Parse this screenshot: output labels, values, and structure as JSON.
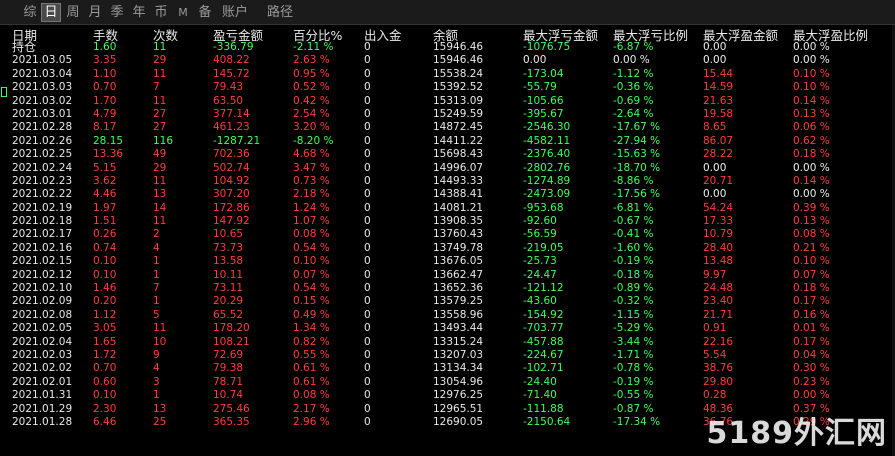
{
  "tabs": [
    "综",
    "日",
    "周",
    "月",
    "季",
    "年",
    "币",
    "M",
    "备",
    "账户",
    "路径"
  ],
  "active_tab": "日",
  "headers": [
    "日期",
    "手数",
    "次数",
    "盈亏金额",
    "百分比%",
    "出入金",
    "余额",
    "最大浮亏金额",
    "最大浮亏比例",
    "最大浮盈金额",
    "最大浮盈比例"
  ],
  "watermark": "5189外汇网",
  "colors": {
    "profit": "#ff3b3b",
    "loss": "#3cff5a",
    "neutral": "#ececec"
  },
  "rows": [
    {
      "date": "持仓",
      "lots": "1.60",
      "count": "11",
      "pnl": "-336.79",
      "pct": "-2.11 %",
      "flow": "0",
      "balance": "15946.46",
      "max_dd": "-1076.75",
      "max_dd_pct": "-6.87 %",
      "max_fp": "0.00",
      "max_fp_pct": "0.00 %",
      "sign": "loss",
      "dd_sign": "loss",
      "fp_sign": "neutral"
    },
    {
      "date": "2021.03.05",
      "lots": "3.35",
      "count": "29",
      "pnl": "408.22",
      "pct": "2.63 %",
      "flow": "0",
      "balance": "15946.46",
      "max_dd": "0.00",
      "max_dd_pct": "0.00 %",
      "max_fp": "0.00",
      "max_fp_pct": "0.00 %",
      "sign": "profit",
      "dd_sign": "neutral",
      "fp_sign": "neutral"
    },
    {
      "date": "2021.03.04",
      "lots": "1.10",
      "count": "11",
      "pnl": "145.72",
      "pct": "0.95 %",
      "flow": "0",
      "balance": "15538.24",
      "max_dd": "-173.04",
      "max_dd_pct": "-1.12 %",
      "max_fp": "15.44",
      "max_fp_pct": "0.10 %",
      "sign": "profit",
      "dd_sign": "loss",
      "fp_sign": "profit"
    },
    {
      "date": "2021.03.03",
      "lots": "0.70",
      "count": "7",
      "pnl": "79.43",
      "pct": "0.52 %",
      "flow": "0",
      "balance": "15392.52",
      "max_dd": "-55.79",
      "max_dd_pct": "-0.36 %",
      "max_fp": "14.59",
      "max_fp_pct": "0.10 %",
      "sign": "profit",
      "dd_sign": "loss",
      "fp_sign": "profit"
    },
    {
      "date": "2021.03.02",
      "lots": "1.70",
      "count": "11",
      "pnl": "63.50",
      "pct": "0.42 %",
      "flow": "0",
      "balance": "15313.09",
      "max_dd": "-105.66",
      "max_dd_pct": "-0.69 %",
      "max_fp": "21.63",
      "max_fp_pct": "0.14 %",
      "sign": "profit",
      "dd_sign": "loss",
      "fp_sign": "profit"
    },
    {
      "date": "2021.03.01",
      "lots": "4.79",
      "count": "27",
      "pnl": "377.14",
      "pct": "2.54 %",
      "flow": "0",
      "balance": "15249.59",
      "max_dd": "-395.67",
      "max_dd_pct": "-2.64 %",
      "max_fp": "19.58",
      "max_fp_pct": "0.13 %",
      "sign": "profit",
      "dd_sign": "loss",
      "fp_sign": "profit"
    },
    {
      "date": "2021.02.28",
      "lots": "8.17",
      "count": "27",
      "pnl": "461.23",
      "pct": "3.20 %",
      "flow": "0",
      "balance": "14872.45",
      "max_dd": "-2546.30",
      "max_dd_pct": "-17.67 %",
      "max_fp": "8.65",
      "max_fp_pct": "0.06 %",
      "sign": "profit",
      "dd_sign": "loss",
      "fp_sign": "profit"
    },
    {
      "date": "2021.02.26",
      "lots": "28.15",
      "count": "116",
      "pnl": "-1287.21",
      "pct": "-8.20 %",
      "flow": "0",
      "balance": "14411.22",
      "max_dd": "-4582.11",
      "max_dd_pct": "-27.94 %",
      "max_fp": "86.07",
      "max_fp_pct": "0.62 %",
      "sign": "loss",
      "dd_sign": "loss",
      "fp_sign": "profit"
    },
    {
      "date": "2021.02.25",
      "lots": "13.36",
      "count": "49",
      "pnl": "702.36",
      "pct": "4.68 %",
      "flow": "0",
      "balance": "15698.43",
      "max_dd": "-2376.40",
      "max_dd_pct": "-15.63 %",
      "max_fp": "28.22",
      "max_fp_pct": "0.18 %",
      "sign": "profit",
      "dd_sign": "loss",
      "fp_sign": "profit"
    },
    {
      "date": "2021.02.24",
      "lots": "5.15",
      "count": "29",
      "pnl": "502.74",
      "pct": "3.47 %",
      "flow": "0",
      "balance": "14996.07",
      "max_dd": "-2802.76",
      "max_dd_pct": "-18.70 %",
      "max_fp": "0.00",
      "max_fp_pct": "0.00 %",
      "sign": "profit",
      "dd_sign": "loss",
      "fp_sign": "neutral"
    },
    {
      "date": "2021.02.23",
      "lots": "3.62",
      "count": "11",
      "pnl": "104.92",
      "pct": "0.73 %",
      "flow": "0",
      "balance": "14493.33",
      "max_dd": "-1274.89",
      "max_dd_pct": "-8.86 %",
      "max_fp": "20.71",
      "max_fp_pct": "0.14 %",
      "sign": "profit",
      "dd_sign": "loss",
      "fp_sign": "profit"
    },
    {
      "date": "2021.02.22",
      "lots": "4.46",
      "count": "13",
      "pnl": "307.20",
      "pct": "2.18 %",
      "flow": "0",
      "balance": "14388.41",
      "max_dd": "-2473.09",
      "max_dd_pct": "-17.56 %",
      "max_fp": "0.00",
      "max_fp_pct": "0.00 %",
      "sign": "profit",
      "dd_sign": "loss",
      "fp_sign": "neutral"
    },
    {
      "date": "2021.02.19",
      "lots": "1.97",
      "count": "14",
      "pnl": "172.86",
      "pct": "1.24 %",
      "flow": "0",
      "balance": "14081.21",
      "max_dd": "-953.68",
      "max_dd_pct": "-6.81 %",
      "max_fp": "54.24",
      "max_fp_pct": "0.39 %",
      "sign": "profit",
      "dd_sign": "loss",
      "fp_sign": "profit"
    },
    {
      "date": "2021.02.18",
      "lots": "1.51",
      "count": "11",
      "pnl": "147.92",
      "pct": "1.07 %",
      "flow": "0",
      "balance": "13908.35",
      "max_dd": "-92.60",
      "max_dd_pct": "-0.67 %",
      "max_fp": "17.33",
      "max_fp_pct": "0.13 %",
      "sign": "profit",
      "dd_sign": "loss",
      "fp_sign": "profit"
    },
    {
      "date": "2021.02.17",
      "lots": "0.26",
      "count": "2",
      "pnl": "10.65",
      "pct": "0.08 %",
      "flow": "0",
      "balance": "13760.43",
      "max_dd": "-56.59",
      "max_dd_pct": "-0.41 %",
      "max_fp": "10.79",
      "max_fp_pct": "0.08 %",
      "sign": "profit",
      "dd_sign": "loss",
      "fp_sign": "profit"
    },
    {
      "date": "2021.02.16",
      "lots": "0.74",
      "count": "4",
      "pnl": "73.73",
      "pct": "0.54 %",
      "flow": "0",
      "balance": "13749.78",
      "max_dd": "-219.05",
      "max_dd_pct": "-1.60 %",
      "max_fp": "28.40",
      "max_fp_pct": "0.21 %",
      "sign": "profit",
      "dd_sign": "loss",
      "fp_sign": "profit"
    },
    {
      "date": "2021.02.15",
      "lots": "0.10",
      "count": "1",
      "pnl": "13.58",
      "pct": "0.10 %",
      "flow": "0",
      "balance": "13676.05",
      "max_dd": "-25.73",
      "max_dd_pct": "-0.19 %",
      "max_fp": "13.48",
      "max_fp_pct": "0.10 %",
      "sign": "profit",
      "dd_sign": "loss",
      "fp_sign": "profit"
    },
    {
      "date": "2021.02.12",
      "lots": "0.10",
      "count": "1",
      "pnl": "10.11",
      "pct": "0.07 %",
      "flow": "0",
      "balance": "13662.47",
      "max_dd": "-24.47",
      "max_dd_pct": "-0.18 %",
      "max_fp": "9.97",
      "max_fp_pct": "0.07 %",
      "sign": "profit",
      "dd_sign": "loss",
      "fp_sign": "profit"
    },
    {
      "date": "2021.02.10",
      "lots": "1.46",
      "count": "7",
      "pnl": "73.11",
      "pct": "0.54 %",
      "flow": "0",
      "balance": "13652.36",
      "max_dd": "-121.12",
      "max_dd_pct": "-0.89 %",
      "max_fp": "24.48",
      "max_fp_pct": "0.18 %",
      "sign": "profit",
      "dd_sign": "loss",
      "fp_sign": "profit"
    },
    {
      "date": "2021.02.09",
      "lots": "0.20",
      "count": "1",
      "pnl": "20.29",
      "pct": "0.15 %",
      "flow": "0",
      "balance": "13579.25",
      "max_dd": "-43.60",
      "max_dd_pct": "-0.32 %",
      "max_fp": "23.40",
      "max_fp_pct": "0.17 %",
      "sign": "profit",
      "dd_sign": "loss",
      "fp_sign": "profit"
    },
    {
      "date": "2021.02.08",
      "lots": "1.12",
      "count": "5",
      "pnl": "65.52",
      "pct": "0.49 %",
      "flow": "0",
      "balance": "13558.96",
      "max_dd": "-154.92",
      "max_dd_pct": "-1.15 %",
      "max_fp": "21.71",
      "max_fp_pct": "0.16 %",
      "sign": "profit",
      "dd_sign": "loss",
      "fp_sign": "profit"
    },
    {
      "date": "2021.02.05",
      "lots": "3.05",
      "count": "11",
      "pnl": "178.20",
      "pct": "1.34 %",
      "flow": "0",
      "balance": "13493.44",
      "max_dd": "-703.77",
      "max_dd_pct": "-5.29 %",
      "max_fp": "0.91",
      "max_fp_pct": "0.01 %",
      "sign": "profit",
      "dd_sign": "loss",
      "fp_sign": "profit"
    },
    {
      "date": "2021.02.04",
      "lots": "1.65",
      "count": "10",
      "pnl": "108.21",
      "pct": "0.82 %",
      "flow": "0",
      "balance": "13315.24",
      "max_dd": "-457.88",
      "max_dd_pct": "-3.44 %",
      "max_fp": "22.16",
      "max_fp_pct": "0.17 %",
      "sign": "profit",
      "dd_sign": "loss",
      "fp_sign": "profit"
    },
    {
      "date": "2021.02.03",
      "lots": "1.72",
      "count": "9",
      "pnl": "72.69",
      "pct": "0.55 %",
      "flow": "0",
      "balance": "13207.03",
      "max_dd": "-224.67",
      "max_dd_pct": "-1.71 %",
      "max_fp": "5.54",
      "max_fp_pct": "0.04 %",
      "sign": "profit",
      "dd_sign": "loss",
      "fp_sign": "profit"
    },
    {
      "date": "2021.02.02",
      "lots": "0.70",
      "count": "4",
      "pnl": "79.38",
      "pct": "0.61 %",
      "flow": "0",
      "balance": "13134.34",
      "max_dd": "-102.71",
      "max_dd_pct": "-0.78 %",
      "max_fp": "38.76",
      "max_fp_pct": "0.30 %",
      "sign": "profit",
      "dd_sign": "loss",
      "fp_sign": "profit"
    },
    {
      "date": "2021.02.01",
      "lots": "0.60",
      "count": "3",
      "pnl": "78.71",
      "pct": "0.61 %",
      "flow": "0",
      "balance": "13054.96",
      "max_dd": "-24.40",
      "max_dd_pct": "-0.19 %",
      "max_fp": "29.80",
      "max_fp_pct": "0.23 %",
      "sign": "profit",
      "dd_sign": "loss",
      "fp_sign": "profit"
    },
    {
      "date": "2021.01.31",
      "lots": "0.10",
      "count": "1",
      "pnl": "10.74",
      "pct": "0.08 %",
      "flow": "0",
      "balance": "12976.25",
      "max_dd": "-71.40",
      "max_dd_pct": "-0.55 %",
      "max_fp": "0.28",
      "max_fp_pct": "0.00 %",
      "sign": "profit",
      "dd_sign": "loss",
      "fp_sign": "profit"
    },
    {
      "date": "2021.01.29",
      "lots": "2.30",
      "count": "13",
      "pnl": "275.46",
      "pct": "2.17 %",
      "flow": "0",
      "balance": "12965.51",
      "max_dd": "-111.88",
      "max_dd_pct": "-0.87 %",
      "max_fp": "48.36",
      "max_fp_pct": "0.37 %",
      "sign": "profit",
      "dd_sign": "loss",
      "fp_sign": "profit"
    },
    {
      "date": "2021.01.28",
      "lots": "6.46",
      "count": "25",
      "pnl": "365.35",
      "pct": "2.96 %",
      "flow": "0",
      "balance": "12690.05",
      "max_dd": "-2150.64",
      "max_dd_pct": "-17.34 %",
      "max_fp": "36.76",
      "max_fp_pct": "0.29 %",
      "sign": "profit",
      "dd_sign": "loss",
      "fp_sign": "profit"
    }
  ]
}
